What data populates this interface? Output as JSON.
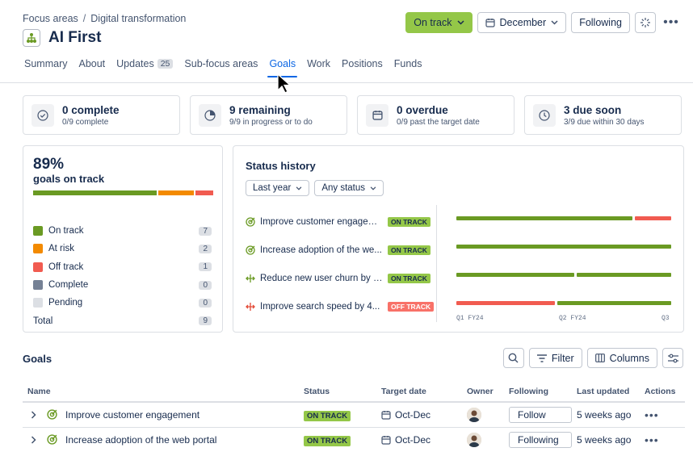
{
  "breadcrumb": {
    "parent": "Focus areas",
    "separator": "/",
    "current": "Digital transformation"
  },
  "page": {
    "title": "AI First"
  },
  "header_actions": {
    "status": "On track",
    "month": "December",
    "following": "Following"
  },
  "tabs": [
    {
      "label": "Summary"
    },
    {
      "label": "About"
    },
    {
      "label": "Updates",
      "count": "25"
    },
    {
      "label": "Sub-focus areas"
    },
    {
      "label": "Goals",
      "active": true
    },
    {
      "label": "Work"
    },
    {
      "label": "Positions"
    },
    {
      "label": "Funds"
    }
  ],
  "stats": [
    {
      "icon": "check-circle-icon",
      "title": "0 complete",
      "sub": "0/9 complete"
    },
    {
      "icon": "pie-chart-icon",
      "title": "9 remaining",
      "sub": "9/9 in progress or to do"
    },
    {
      "icon": "calendar-icon",
      "title": "0 overdue",
      "sub": "0/9 past the target date"
    },
    {
      "icon": "clock-icon",
      "title": "3 due soon",
      "sub": "3/9 due within 30 days"
    }
  ],
  "ontrack_card": {
    "percent": "89%",
    "label": "goals on track",
    "legend": [
      {
        "label": "On track",
        "count": "7",
        "color": "#6a9a23"
      },
      {
        "label": "At risk",
        "count": "2",
        "color": "#f38a00"
      },
      {
        "label": "Off track",
        "count": "1",
        "color": "#f15b50"
      },
      {
        "label": "Complete",
        "count": "0",
        "color": "#758195"
      },
      {
        "label": "Pending",
        "count": "0",
        "color": "#dcdfe4"
      }
    ],
    "total_label": "Total",
    "total_count": "9"
  },
  "status_history": {
    "title": "Status history",
    "filter_period": "Last year",
    "filter_status": "Any status",
    "goals": [
      {
        "name": "Improve customer engagem...",
        "status": "ON TRACK",
        "icon": "goal-target-icon"
      },
      {
        "name": "Increase adoption of the we...",
        "status": "ON TRACK",
        "icon": "goal-target-icon"
      },
      {
        "name": "Reduce new user churn by 1...",
        "status": "ON TRACK",
        "icon": "arrows-icon"
      },
      {
        "name": "Improve search speed by 4...",
        "status": "OFF TRACK",
        "icon": "arrows-icon"
      }
    ],
    "timeline": [
      {
        "segments": [
          {
            "status": "on",
            "share": 0.83
          },
          {
            "status": "off",
            "share": 0.17
          }
        ]
      },
      {
        "segments": [
          {
            "status": "on",
            "share": 1.0
          }
        ]
      },
      {
        "segments": [
          {
            "status": "on",
            "share": 0.56
          },
          {
            "status": "on",
            "share": 0.44
          }
        ]
      },
      {
        "segments": [
          {
            "status": "off",
            "share": 0.47
          },
          {
            "status": "on",
            "share": 0.53
          }
        ]
      }
    ],
    "axis_labels": [
      "Q1 FY24",
      "Q2 FY24",
      "Q3"
    ],
    "colors": {
      "on": "#6a9a23",
      "off": "#f15b50"
    }
  },
  "goals_table": {
    "title": "Goals",
    "filter_label": "Filter",
    "columns_label": "Columns",
    "headers": [
      "Name",
      "Status",
      "Target date",
      "Owner",
      "Following",
      "Last updated",
      "Actions"
    ],
    "rows": [
      {
        "name": "Improve customer engagement",
        "status": "ON TRACK",
        "target": "Oct-Dec",
        "following": "Follow",
        "updated": "5 weeks ago"
      },
      {
        "name": "Increase adoption of the web portal",
        "status": "ON TRACK",
        "target": "Oct-Dec",
        "following": "Following",
        "updated": "5 weeks ago"
      }
    ]
  }
}
